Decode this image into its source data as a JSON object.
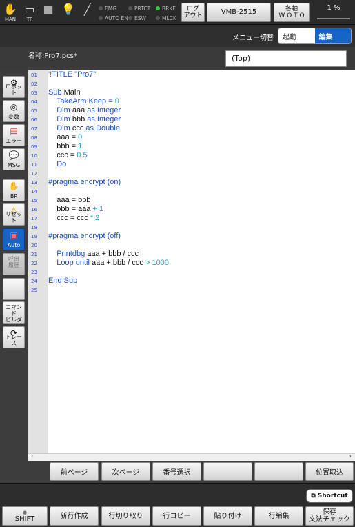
{
  "topbar": {
    "man_label": "MAN",
    "tp_label": "TP",
    "indicators": {
      "emg": "EMG",
      "auto_en": "AUTO EN",
      "prtct": "PRTCT",
      "esw": "ESW",
      "brke": "BRKE",
      "mlck": "MLCK"
    },
    "logout_label": "ログ\nアウト",
    "robot_name": "VMB-2515",
    "axis_label": "各軸\nW O T O",
    "speed": "1 %"
  },
  "menu": {
    "switch_label": "メニュー切替",
    "start_label": "起動",
    "edit_label": "編集"
  },
  "file": {
    "name": "名称:Pro7.pcs*",
    "scope": "(Top)"
  },
  "left_tools": [
    {
      "label": "ロボット"
    },
    {
      "label": "変数"
    },
    {
      "label": "エラー"
    },
    {
      "label": "MSG"
    },
    {
      "label": "BP"
    },
    {
      "label": "リセット"
    },
    {
      "label": "Auto"
    },
    {
      "label": "呼出\n履歴"
    },
    {
      "label": ""
    },
    {
      "label": "コマンド\nビルダ"
    },
    {
      "label": "トレース"
    }
  ],
  "code": {
    "numbers": [
      "01",
      "02",
      "03",
      "04",
      "05",
      "06",
      "07",
      "08",
      "09",
      "10",
      "11",
      "12",
      "13",
      "14",
      "15",
      "16",
      "17",
      "18",
      "19",
      "20",
      "21",
      "22",
      "23",
      "24",
      "25"
    ],
    "l1": "'!TITLE \"Pro7\"",
    "l3a": "Sub",
    "l3b": " Main",
    "l4a": "    TakeArm Keep = ",
    "l4b": "0",
    "l5a": "    Dim",
    "l5b": " aaa ",
    "l5c": "as Integer",
    "l6a": "    Dim",
    "l6b": " bbb ",
    "l6c": "as Integer",
    "l7a": "    Dim",
    "l7b": " ccc ",
    "l7c": "as Double",
    "l8a": "    aaa = ",
    "l8b": "0",
    "l9a": "    bbb = ",
    "l9b": "1",
    "l10a": "    ccc = ",
    "l10b": "0.5",
    "l11": "    Do",
    "l13": "#pragma encrypt (on)",
    "l15": "    aaa = bbb",
    "l16a": "    bbb = aaa ",
    "l16b": "+ 1",
    "l17a": "    ccc = ccc ",
    "l17b": "* 2",
    "l19": "#pragma encrypt (off)",
    "l21a": "    Printdbg",
    "l21b": " aaa + bbb / ccc",
    "l22a": "    Loop until",
    "l22b": " aaa + bbb / ccc ",
    "l22c": "> 1000",
    "l24": "End Sub"
  },
  "page_buttons": {
    "prev": "前ページ",
    "next": "次ページ",
    "number_select": "番号選択",
    "blank1": "",
    "blank2": "",
    "position": "位置取込"
  },
  "bottom": {
    "shortcut": "Shortcut",
    "shift": "SHIFT",
    "new_line": "新行作成",
    "cut_line": "行切り取り",
    "copy_line": "行コピー",
    "paste": "貼り付け",
    "edit_line": "行編集",
    "save_check": "保存\n文法チェック"
  },
  "colors": {
    "accent": "#1764c8",
    "keyword": "#1a4fd6",
    "number": "#1aa3b8",
    "indicator_on": "#2ecc40"
  }
}
